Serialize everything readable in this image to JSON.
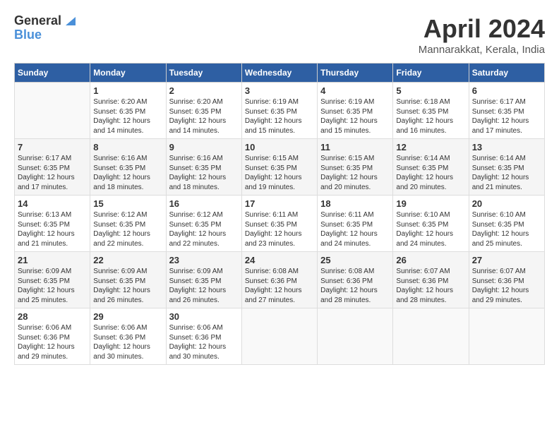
{
  "logo": {
    "general": "General",
    "blue": "Blue"
  },
  "title": "April 2024",
  "location": "Mannarakkat, Kerala, India",
  "days_of_week": [
    "Sunday",
    "Monday",
    "Tuesday",
    "Wednesday",
    "Thursday",
    "Friday",
    "Saturday"
  ],
  "weeks": [
    [
      {
        "day": "",
        "info": ""
      },
      {
        "day": "1",
        "info": "Sunrise: 6:20 AM\nSunset: 6:35 PM\nDaylight: 12 hours\nand 14 minutes."
      },
      {
        "day": "2",
        "info": "Sunrise: 6:20 AM\nSunset: 6:35 PM\nDaylight: 12 hours\nand 14 minutes."
      },
      {
        "day": "3",
        "info": "Sunrise: 6:19 AM\nSunset: 6:35 PM\nDaylight: 12 hours\nand 15 minutes."
      },
      {
        "day": "4",
        "info": "Sunrise: 6:19 AM\nSunset: 6:35 PM\nDaylight: 12 hours\nand 15 minutes."
      },
      {
        "day": "5",
        "info": "Sunrise: 6:18 AM\nSunset: 6:35 PM\nDaylight: 12 hours\nand 16 minutes."
      },
      {
        "day": "6",
        "info": "Sunrise: 6:17 AM\nSunset: 6:35 PM\nDaylight: 12 hours\nand 17 minutes."
      }
    ],
    [
      {
        "day": "7",
        "info": "Sunrise: 6:17 AM\nSunset: 6:35 PM\nDaylight: 12 hours\nand 17 minutes."
      },
      {
        "day": "8",
        "info": "Sunrise: 6:16 AM\nSunset: 6:35 PM\nDaylight: 12 hours\nand 18 minutes."
      },
      {
        "day": "9",
        "info": "Sunrise: 6:16 AM\nSunset: 6:35 PM\nDaylight: 12 hours\nand 18 minutes."
      },
      {
        "day": "10",
        "info": "Sunrise: 6:15 AM\nSunset: 6:35 PM\nDaylight: 12 hours\nand 19 minutes."
      },
      {
        "day": "11",
        "info": "Sunrise: 6:15 AM\nSunset: 6:35 PM\nDaylight: 12 hours\nand 20 minutes."
      },
      {
        "day": "12",
        "info": "Sunrise: 6:14 AM\nSunset: 6:35 PM\nDaylight: 12 hours\nand 20 minutes."
      },
      {
        "day": "13",
        "info": "Sunrise: 6:14 AM\nSunset: 6:35 PM\nDaylight: 12 hours\nand 21 minutes."
      }
    ],
    [
      {
        "day": "14",
        "info": "Sunrise: 6:13 AM\nSunset: 6:35 PM\nDaylight: 12 hours\nand 21 minutes."
      },
      {
        "day": "15",
        "info": "Sunrise: 6:12 AM\nSunset: 6:35 PM\nDaylight: 12 hours\nand 22 minutes."
      },
      {
        "day": "16",
        "info": "Sunrise: 6:12 AM\nSunset: 6:35 PM\nDaylight: 12 hours\nand 22 minutes."
      },
      {
        "day": "17",
        "info": "Sunrise: 6:11 AM\nSunset: 6:35 PM\nDaylight: 12 hours\nand 23 minutes."
      },
      {
        "day": "18",
        "info": "Sunrise: 6:11 AM\nSunset: 6:35 PM\nDaylight: 12 hours\nand 24 minutes."
      },
      {
        "day": "19",
        "info": "Sunrise: 6:10 AM\nSunset: 6:35 PM\nDaylight: 12 hours\nand 24 minutes."
      },
      {
        "day": "20",
        "info": "Sunrise: 6:10 AM\nSunset: 6:35 PM\nDaylight: 12 hours\nand 25 minutes."
      }
    ],
    [
      {
        "day": "21",
        "info": "Sunrise: 6:09 AM\nSunset: 6:35 PM\nDaylight: 12 hours\nand 25 minutes."
      },
      {
        "day": "22",
        "info": "Sunrise: 6:09 AM\nSunset: 6:35 PM\nDaylight: 12 hours\nand 26 minutes."
      },
      {
        "day": "23",
        "info": "Sunrise: 6:09 AM\nSunset: 6:35 PM\nDaylight: 12 hours\nand 26 minutes."
      },
      {
        "day": "24",
        "info": "Sunrise: 6:08 AM\nSunset: 6:36 PM\nDaylight: 12 hours\nand 27 minutes."
      },
      {
        "day": "25",
        "info": "Sunrise: 6:08 AM\nSunset: 6:36 PM\nDaylight: 12 hours\nand 28 minutes."
      },
      {
        "day": "26",
        "info": "Sunrise: 6:07 AM\nSunset: 6:36 PM\nDaylight: 12 hours\nand 28 minutes."
      },
      {
        "day": "27",
        "info": "Sunrise: 6:07 AM\nSunset: 6:36 PM\nDaylight: 12 hours\nand 29 minutes."
      }
    ],
    [
      {
        "day": "28",
        "info": "Sunrise: 6:06 AM\nSunset: 6:36 PM\nDaylight: 12 hours\nand 29 minutes."
      },
      {
        "day": "29",
        "info": "Sunrise: 6:06 AM\nSunset: 6:36 PM\nDaylight: 12 hours\nand 30 minutes."
      },
      {
        "day": "30",
        "info": "Sunrise: 6:06 AM\nSunset: 6:36 PM\nDaylight: 12 hours\nand 30 minutes."
      },
      {
        "day": "",
        "info": ""
      },
      {
        "day": "",
        "info": ""
      },
      {
        "day": "",
        "info": ""
      },
      {
        "day": "",
        "info": ""
      }
    ]
  ]
}
